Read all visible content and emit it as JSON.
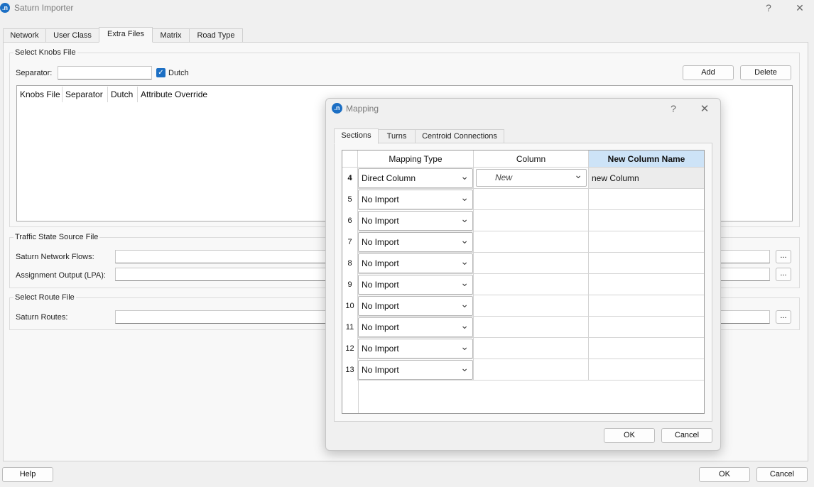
{
  "window": {
    "title": "Saturn Importer",
    "help_glyph": "?",
    "close_glyph": "✕",
    "logo_text": ".n"
  },
  "tabs": [
    {
      "label": "Network"
    },
    {
      "label": "User Class"
    },
    {
      "label": "Extra Files",
      "active": true
    },
    {
      "label": "Matrix"
    },
    {
      "label": "Road Type"
    }
  ],
  "knobs": {
    "group_title": "Select Knobs File",
    "separator_label": "Separator:",
    "separator_value": "",
    "dutch_label": "Dutch",
    "dutch_checked": true,
    "add_label": "Add",
    "delete_label": "Delete",
    "columns": [
      "Knobs File",
      "Separator",
      "Dutch",
      "Attribute Override"
    ]
  },
  "traffic": {
    "group_title": "Traffic State Source File",
    "flows_label": "Saturn Network Flows:",
    "lpa_label": "Assignment Output (LPA):",
    "browse_label": "..."
  },
  "route": {
    "group_title": "Select Route File",
    "routes_label": "Saturn Routes:",
    "browse_label": "..."
  },
  "footer": {
    "help_label": "Help",
    "ok_label": "OK",
    "cancel_label": "Cancel"
  },
  "mapping_dialog": {
    "title": "Mapping",
    "help_glyph": "?",
    "close_glyph": "✕",
    "tabs": [
      {
        "label": "Sections",
        "active": true
      },
      {
        "label": "Turns"
      },
      {
        "label": "Centroid Connections"
      }
    ],
    "headers": [
      "Mapping Type",
      "Column",
      "New Column Name"
    ],
    "rows": [
      {
        "num": "4",
        "type": "Direct Column",
        "column": "New",
        "new_name": "new Column"
      },
      {
        "num": "5",
        "type": "No Import",
        "column": "",
        "new_name": ""
      },
      {
        "num": "6",
        "type": "No Import",
        "column": "",
        "new_name": ""
      },
      {
        "num": "7",
        "type": "No Import",
        "column": "",
        "new_name": ""
      },
      {
        "num": "8",
        "type": "No Import",
        "column": "",
        "new_name": ""
      },
      {
        "num": "9",
        "type": "No Import",
        "column": "",
        "new_name": ""
      },
      {
        "num": "10",
        "type": "No Import",
        "column": "",
        "new_name": ""
      },
      {
        "num": "11",
        "type": "No Import",
        "column": "",
        "new_name": ""
      },
      {
        "num": "12",
        "type": "No Import",
        "column": "",
        "new_name": ""
      },
      {
        "num": "13",
        "type": "No Import",
        "column": "",
        "new_name": ""
      }
    ],
    "ok_label": "OK",
    "cancel_label": "Cancel"
  },
  "colors": {
    "accent": "#1c6fc4",
    "selected_header": "#cde3f7"
  },
  "icons": {
    "app_logo": "app-logo-icon",
    "dropdown": "chevron-down-icon",
    "check": "checkmark-icon"
  }
}
